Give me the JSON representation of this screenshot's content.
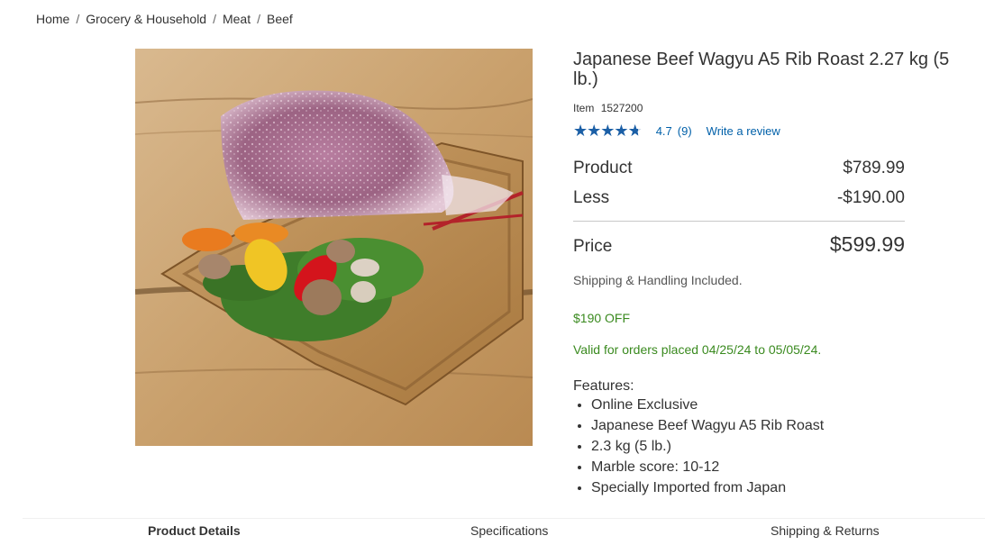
{
  "breadcrumb": {
    "items": [
      "Home",
      "Grocery & Household",
      "Meat",
      "Beef"
    ],
    "separator": "/"
  },
  "product": {
    "title": "Japanese Beef Wagyu A5 Rib Roast 2.27 kg (5 lb.)",
    "item_label": "Item",
    "item_number": "1527200",
    "rating": {
      "stars_value": 4.7,
      "stars_max": 5,
      "value_text": "4.7",
      "count_text": "(9)",
      "write_review": "Write a review"
    },
    "pricing": {
      "product_label": "Product",
      "product_price": "$789.99",
      "less_label": "Less",
      "less_amount": "-$190.00",
      "price_label": "Price",
      "price_amount": "$599.99"
    },
    "shipping_text": "Shipping & Handling Included.",
    "discount_text": "$190 OFF",
    "valid_text": "Valid for orders placed 04/25/24 to 05/05/24.",
    "features_title": "Features:",
    "features": [
      "Online Exclusive",
      "Japanese Beef Wagyu A5 Rib Roast",
      "2.3 kg (5 lb.)",
      "Marble score: 10-12",
      "Specially Imported from Japan"
    ],
    "image_icon": "product-photo-wagyu-roast"
  },
  "tabs": {
    "items": [
      "Product Details",
      "Specifications",
      "Shipping & Returns"
    ],
    "active": "Product Details"
  },
  "colors": {
    "link": "#0060a9",
    "star": "#1b5fa6",
    "promo_green": "#3a8a1f",
    "text": "#333333"
  }
}
